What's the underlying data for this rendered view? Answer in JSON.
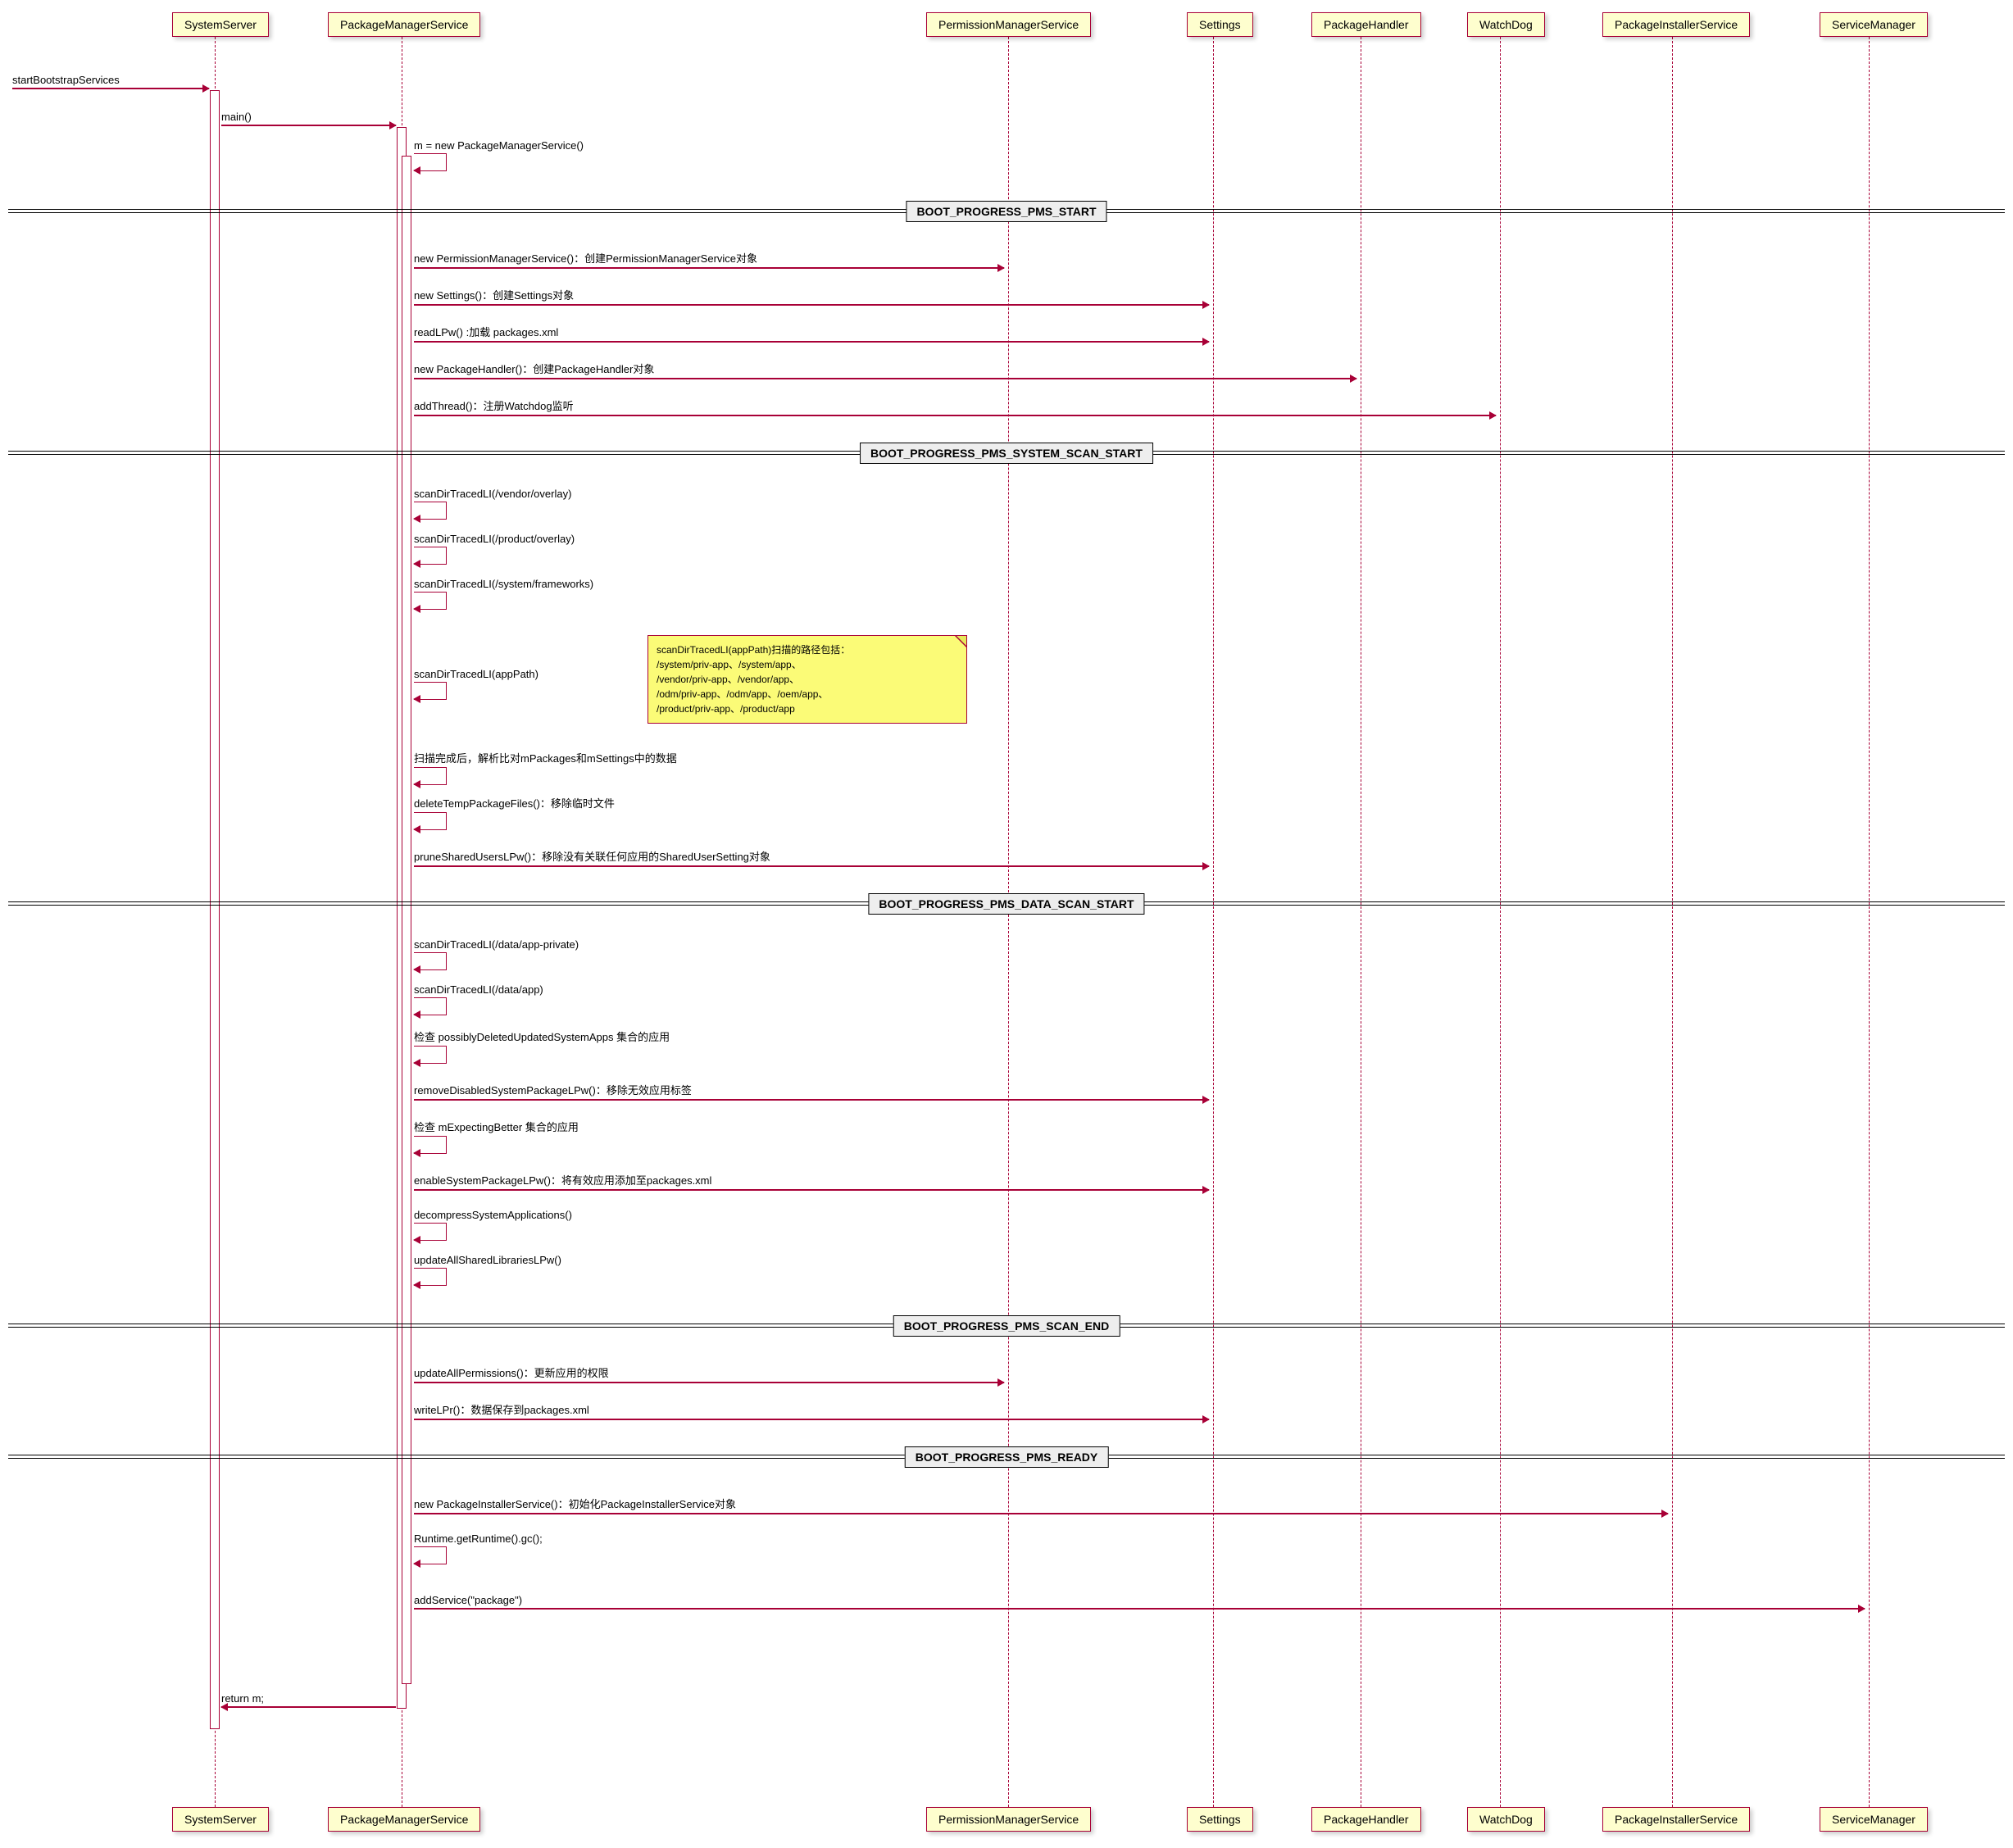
{
  "participants": {
    "p1": "SystemServer",
    "p2": "PackageManagerService",
    "p3": "PermissionManagerService",
    "p4": "Settings",
    "p5": "PackageHandler",
    "p6": "WatchDog",
    "p7": "PackageInstallerService",
    "p8": "ServiceManager"
  },
  "messages": {
    "m1": "startBootstrapServices",
    "m2": "main()",
    "m3": "m = new PackageManagerService()",
    "m4": "new PermissionManagerService()：创建PermissionManagerService对象",
    "m5": "new Settings()：创建Settings对象",
    "m6": "readLPw() :加载 packages.xml",
    "m7": "new PackageHandler()：创建PackageHandler对象",
    "m8": "addThread()：注册Watchdog监听",
    "m9": "scanDirTracedLI(/vendor/overlay)",
    "m10": "scanDirTracedLI(/product/overlay)",
    "m11": "scanDirTracedLI(/system/frameworks)",
    "m12": "scanDirTracedLI(appPath)",
    "m13": "扫描完成后，解析比对mPackages和mSettings中的数据",
    "m14": "deleteTempPackageFiles()：移除临时文件",
    "m15": "pruneSharedUsersLPw()：移除没有关联任何应用的SharedUserSetting对象",
    "m16": "scanDirTracedLI(/data/app-private)",
    "m17": "scanDirTracedLI(/data/app)",
    "m18": "检查 possiblyDeletedUpdatedSystemApps 集合的应用",
    "m19": "removeDisabledSystemPackageLPw()：移除无效应用标签",
    "m20": "检查 mExpectingBetter 集合的应用",
    "m21": "enableSystemPackageLPw()：将有效应用添加至packages.xml",
    "m22": "decompressSystemApplications()",
    "m23": "updateAllSharedLibrariesLPw()",
    "m24": "updateAllPermissions()：更新应用的权限",
    "m25": "writeLPr()：数据保存到packages.xml",
    "m26": "new PackageInstallerService()：初始化PackageInstallerService对象",
    "m27": "Runtime.getRuntime().gc();",
    "m28": "addService(\"package\")",
    "m29": "return m;"
  },
  "dividers": {
    "d1": "BOOT_PROGRESS_PMS_START",
    "d2": "BOOT_PROGRESS_PMS_SYSTEM_SCAN_START",
    "d3": "BOOT_PROGRESS_PMS_DATA_SCAN_START",
    "d4": "BOOT_PROGRESS_PMS_SCAN_END",
    "d5": "BOOT_PROGRESS_PMS_READY"
  },
  "note": {
    "l1": "scanDirTracedLI(appPath)扫描的路径包括：",
    "l2": "/system/priv-app、/system/app、",
    "l3": "/vendor/priv-app、/vendor/app、",
    "l4": "/odm/priv-app、/odm/app、/oem/app、",
    "l5": "/product/priv-app、/product/app"
  }
}
